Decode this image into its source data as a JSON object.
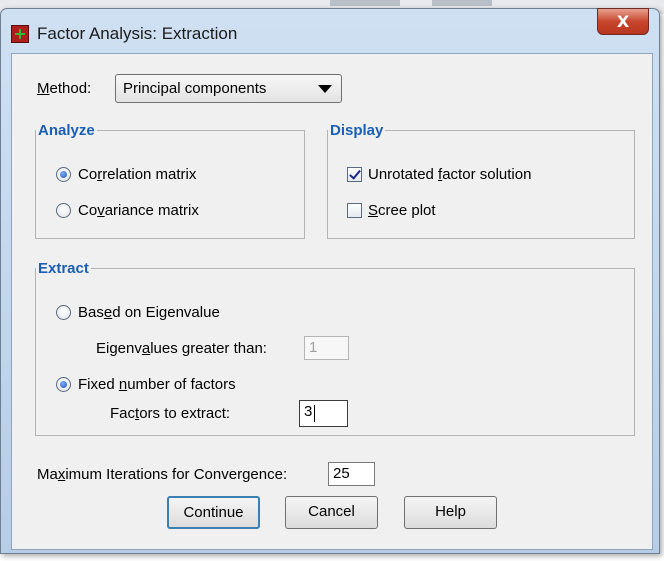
{
  "window": {
    "title": "Factor Analysis: Extraction",
    "close_label": "X"
  },
  "method": {
    "prefix": "M",
    "rest": "ethod:",
    "selected": "Principal components"
  },
  "analyze": {
    "legend": "Analyze",
    "correlation": {
      "pre": "Co",
      "u": "r",
      "post": "relation matrix",
      "selected": true
    },
    "covariance": {
      "pre": "Co",
      "u": "v",
      "post": "ariance matrix",
      "selected": false
    }
  },
  "display": {
    "legend": "Display",
    "unrotated": {
      "pre": "Unrotated ",
      "u": "f",
      "post": "actor solution",
      "checked": true
    },
    "scree": {
      "pre": "",
      "u": "S",
      "post": "cree plot",
      "checked": false
    }
  },
  "extract": {
    "legend": "Extract",
    "eigen_radio": {
      "pre": "Bas",
      "u": "e",
      "post": "d on Eigenvalue",
      "selected": false
    },
    "eigen_label": {
      "pre": "Eigenv",
      "u": "a",
      "post": "lues greater than:"
    },
    "eigen_value": "1",
    "fixed_radio": {
      "pre": "Fixed ",
      "u": "n",
      "post": "umber of factors",
      "selected": true
    },
    "factors_label": {
      "pre": "Fac",
      "u": "t",
      "post": "ors to extract:"
    },
    "factors_value": "3"
  },
  "iterations": {
    "pre": "Ma",
    "u": "x",
    "post": "imum Iterations for Convergence:",
    "value": "25"
  },
  "buttons": {
    "continue": "Continue",
    "cancel": "Cancel",
    "help": "Help"
  }
}
